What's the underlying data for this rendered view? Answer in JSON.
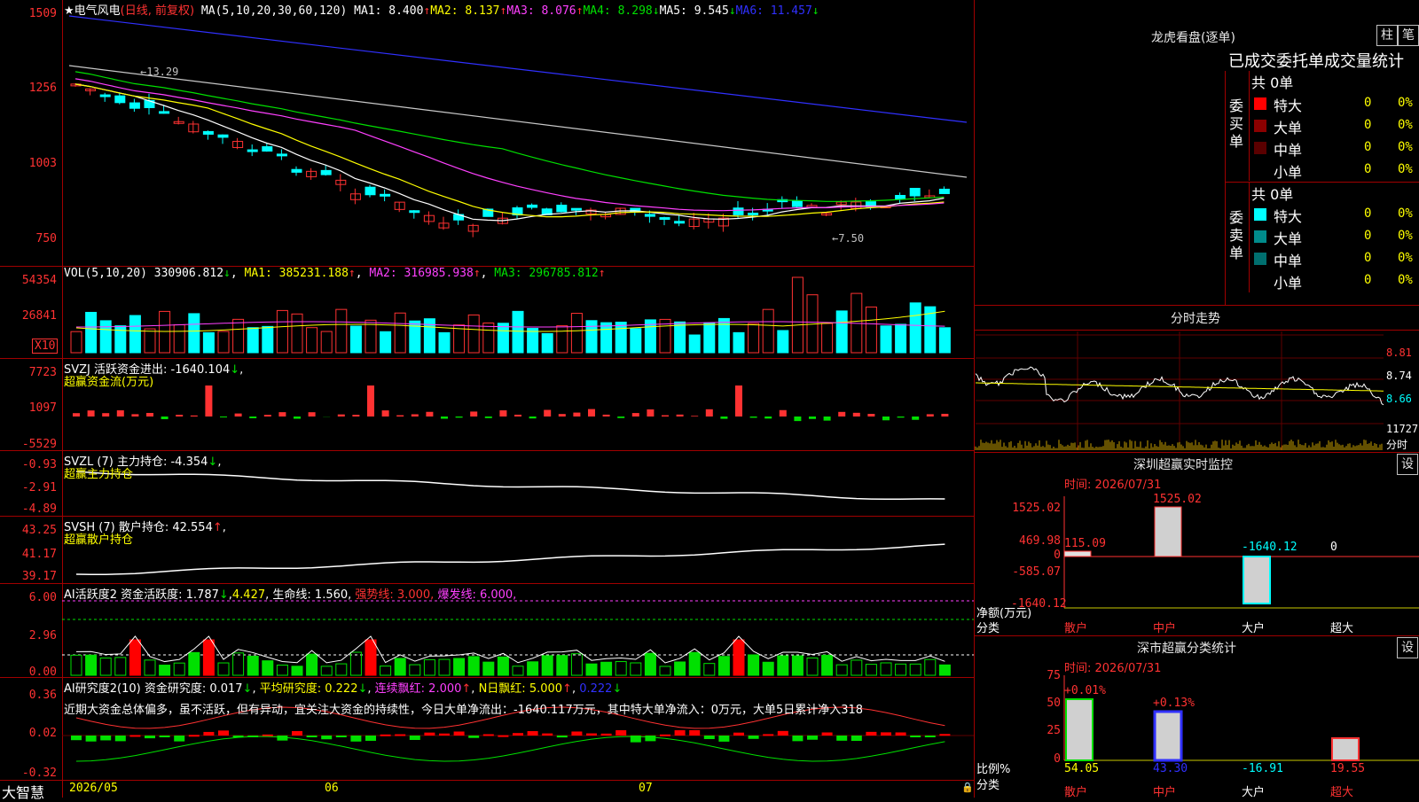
{
  "stock": {
    "name": "电气风电",
    "mode": "(日线, 前复权)"
  },
  "main_indicators": {
    "label": "MA(5,10,20,30,60,120)",
    "ma1": "MA1: 8.400",
    "ma1_arrow": "↑",
    "ma2": "MA2: 8.137",
    "ma2_arrow": "↑",
    "ma3": "MA3: 8.076",
    "ma3_arrow": "↑",
    "ma4": "MA4: 8.298",
    "ma4_arrow": "↓",
    "ma5": "MA5: 9.545",
    "ma5_arrow": "↓",
    "ma6": "MA6: 11.457",
    "ma6_arrow": "↓",
    "high_mark": "13.29",
    "low_mark": "7.50"
  },
  "price_axis": [
    "1509",
    "1256",
    "1003",
    "750"
  ],
  "vol": {
    "label": "VOL(5,10,20)",
    "value": "330906.812",
    "value_arrow": "↓",
    "ma1": "MA1: 385231.188",
    "ma1_arrow": "↑",
    "ma2": "MA2: 316985.938",
    "ma2_arrow": "↑",
    "ma3": "MA3: 296785.812",
    "ma3_arrow": "↑",
    "axis": [
      "54354",
      "26841"
    ],
    "unit": "X10"
  },
  "svzj": {
    "label": "SVZJ  活跃资金进出: -1640.104",
    "arrow": "↓",
    "comma": ",",
    "sub": "超赢资金流(万元)",
    "axis": [
      "7723",
      "1097",
      "-5529"
    ]
  },
  "svzl": {
    "label": "SVZL (7) 主力持仓: -4.354",
    "arrow": "↓",
    "comma": ",",
    "sub": "超赢主力持仓",
    "axis": [
      "-0.93",
      "-2.91",
      "-4.89"
    ]
  },
  "svsh": {
    "label": "SVSH (7) 散户持仓: 42.554",
    "arrow": "↑",
    "comma": ",",
    "sub": "超赢散户持仓",
    "axis": [
      "43.25",
      "41.17",
      "39.17"
    ]
  },
  "ai_active": {
    "label": "AI活跃度2 资金活跃度: 1.787",
    "arrow1": "↓",
    "v2": "4.427",
    "life": "生命线: 1.560,",
    "strong": "强势线: 3.000,",
    "burst": "爆发线: 6.000,",
    "axis": [
      "6.00",
      "2.96",
      "0.00"
    ]
  },
  "ai_research": {
    "label": "AI研究度2(10) 资金研究度: 0.017",
    "arrow1": "↓",
    "avg": "平均研究度: 0.222",
    "arrow2": "↓",
    "streak": "连续飘红: 2.000",
    "arrow3": "↑",
    "ndays": "N日飘红: 5.000",
    "arrow4": "↑",
    "last": "0.222",
    "arrow5": "↓",
    "comment": "近期大资金总体偏多，虽不活跃，但有异动，宜关注大资金的持续性，今日大单净流出：-1640.117万元，其中特大单净流入：0万元，大单5日累计净入318",
    "axis": [
      "0.36",
      "0.02",
      "-0.32"
    ]
  },
  "date_axis": {
    "brand": "大智慧",
    "labels": [
      "2026/05",
      "06",
      "07"
    ]
  },
  "lhb": {
    "title": "龙虎看盘(逐单)",
    "btn_zhu": "柱",
    "btn_bi": "笔",
    "header": "已成交委托单成交量统计",
    "buy_side": "委买单",
    "sell_side": "委卖单",
    "buy_total": "共 0单",
    "sell_total": "共 0单",
    "buy_rows": [
      {
        "label": "特大",
        "count": "0",
        "pct": "0%",
        "color": "#ff0000"
      },
      {
        "label": "大单",
        "count": "0",
        "pct": "0%",
        "color": "#8b0000"
      },
      {
        "label": "中单",
        "count": "0",
        "pct": "0%",
        "color": "#5a0000"
      },
      {
        "label": "小单",
        "count": "0",
        "pct": "0%",
        "color": "#000000"
      }
    ],
    "sell_rows": [
      {
        "label": "特大",
        "count": "0",
        "pct": "0%",
        "color": "#00ffff"
      },
      {
        "label": "大单",
        "count": "0",
        "pct": "0%",
        "color": "#008b8b"
      },
      {
        "label": "中单",
        "count": "0",
        "pct": "0%",
        "color": "#006f6f"
      },
      {
        "label": "小单",
        "count": "0",
        "pct": "0%",
        "color": "#000000"
      }
    ]
  },
  "intraday": {
    "title": "分时走势",
    "axis": [
      "8.81",
      "8.74",
      "8.66"
    ],
    "vol": "11727",
    "unit": "分时"
  },
  "sz_monitor": {
    "title": "深圳超赢实时监控",
    "btn": "设",
    "time": "时间: 2026/07/31",
    "axis": [
      "1525.02",
      "469.98",
      "0",
      "-585.07",
      "-1640.12"
    ],
    "bar_labels": [
      "115.09",
      "1525.02",
      "-1640.12",
      "0"
    ],
    "ylabel": "净额(万元)",
    "xlabel": "分类",
    "cats": [
      "散户",
      "中户",
      "大户",
      "超大"
    ]
  },
  "sz_stats": {
    "title": "深市超赢分类统计",
    "btn": "设",
    "time": "时间: 2026/07/31",
    "axis": [
      "75",
      "50",
      "25",
      "0"
    ],
    "top_labels": [
      "+0.01%",
      "+0.13%"
    ],
    "values": [
      "54.05",
      "43.30",
      "-16.91",
      "19.55"
    ],
    "ylabel": "比例%",
    "xlabel": "分类",
    "cats": [
      "散户",
      "中户",
      "大户",
      "超大"
    ]
  }
}
